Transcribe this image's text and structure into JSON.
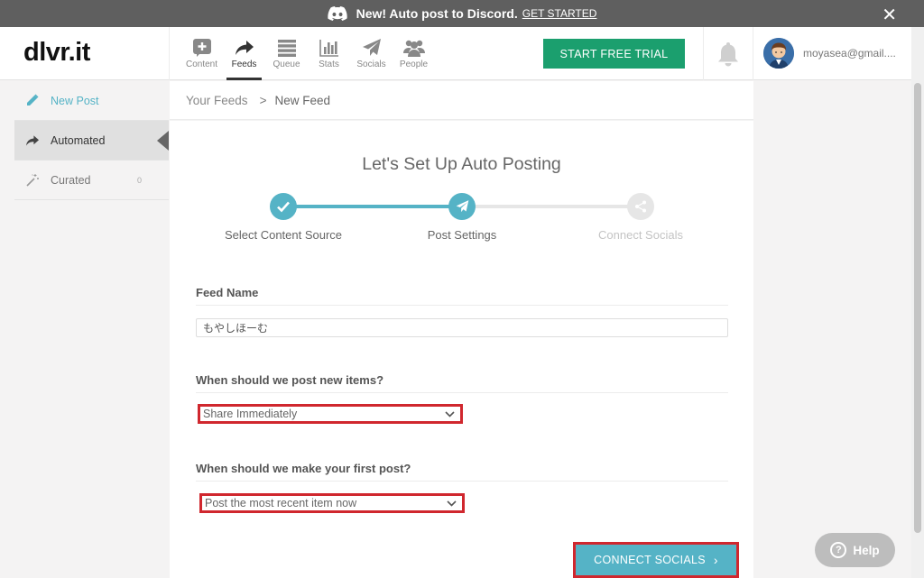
{
  "banner": {
    "text": "New! Auto post to Discord.",
    "link": "GET STARTED",
    "close_symbol": "✕"
  },
  "header": {
    "logo": "dlvr.it",
    "nav": [
      {
        "label": "Content",
        "icon": "plus-box-icon",
        "active": false
      },
      {
        "label": "Feeds",
        "icon": "share-arrow-icon",
        "active": true
      },
      {
        "label": "Queue",
        "icon": "list-icon",
        "active": false
      },
      {
        "label": "Stats",
        "icon": "bar-chart-icon",
        "active": false
      },
      {
        "label": "Socials",
        "icon": "paper-plane-icon",
        "active": false
      },
      {
        "label": "People",
        "icon": "people-icon",
        "active": false
      }
    ],
    "trial_button": "START FREE TRIAL",
    "user_email": "moyasea@gmail...."
  },
  "sidebar": {
    "items": [
      {
        "label": "New Post",
        "icon": "pencil-icon"
      },
      {
        "label": "Automated",
        "icon": "share-arrow-icon"
      },
      {
        "label": "Curated",
        "icon": "magic-wand-icon",
        "count": "0"
      }
    ]
  },
  "breadcrumb": {
    "parent": "Your Feeds",
    "separator": ">",
    "current": "New Feed"
  },
  "wizard": {
    "title": "Let's Set Up Auto Posting",
    "steps": [
      {
        "label": "Select Content Source",
        "status": "done",
        "icon": "check-icon"
      },
      {
        "label": "Post Settings",
        "status": "current",
        "icon": "paper-plane-icon"
      },
      {
        "label": "Connect Socials",
        "status": "pending",
        "icon": "share-icon"
      }
    ]
  },
  "form": {
    "feed_name_label": "Feed Name",
    "feed_name_value": "もやしほーむ",
    "post_new_label": "When should we post new items?",
    "post_new_value": "Share Immediately",
    "first_post_label": "When should we make your first post?",
    "first_post_value": "Post the most recent item now",
    "connect_button": "CONNECT SOCIALS",
    "connect_arrow": "›"
  },
  "help": {
    "label": "Help",
    "icon_glyph": "?"
  },
  "colors": {
    "accent": "#55b3c6",
    "trial": "#1b9f6e",
    "highlight": "#d0272e",
    "banner": "#5f5f5f"
  }
}
